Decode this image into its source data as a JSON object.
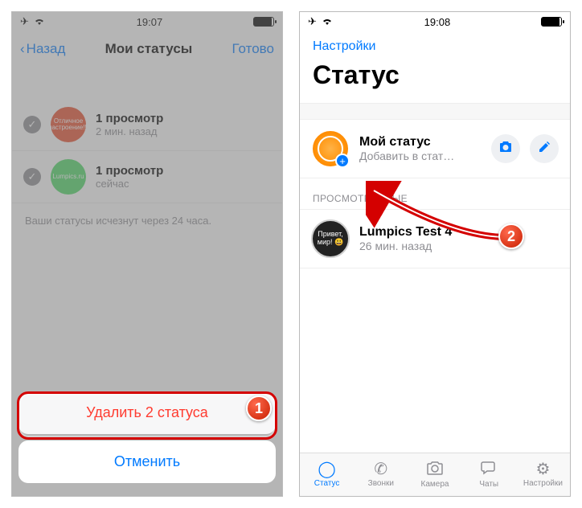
{
  "left": {
    "time": "19:07",
    "nav": {
      "back": "Назад",
      "title": "Мои статусы",
      "done": "Готово"
    },
    "rows": [
      {
        "avatar_text": "Отличное настроение!!!",
        "title": "1 просмотр",
        "subtitle": "2 мин. назад"
      },
      {
        "avatar_text": "Lumpics.ru",
        "title": "1 просмотр",
        "subtitle": "сейчас"
      }
    ],
    "footer": "Ваши статусы исчезнут через 24 часа.",
    "sheet": {
      "delete": "Удалить 2 статуса",
      "cancel": "Отменить"
    }
  },
  "right": {
    "time": "19:08",
    "nav_link": "Настройки",
    "title": "Статус",
    "my_status": {
      "title": "Мой статус",
      "subtitle": "Добавить в стат…"
    },
    "section_viewed": "ПРОСМОТРЕННЫЕ",
    "viewed_row": {
      "avatar_text": "Привет, мир! 😃",
      "title": "Lumpics Test 4",
      "subtitle": "26 мин. назад"
    },
    "tabs": {
      "status": "Статус",
      "calls": "Звонки",
      "camera": "Камера",
      "chats": "Чаты",
      "settings": "Настройки"
    }
  },
  "badges": {
    "one": "1",
    "two": "2"
  }
}
